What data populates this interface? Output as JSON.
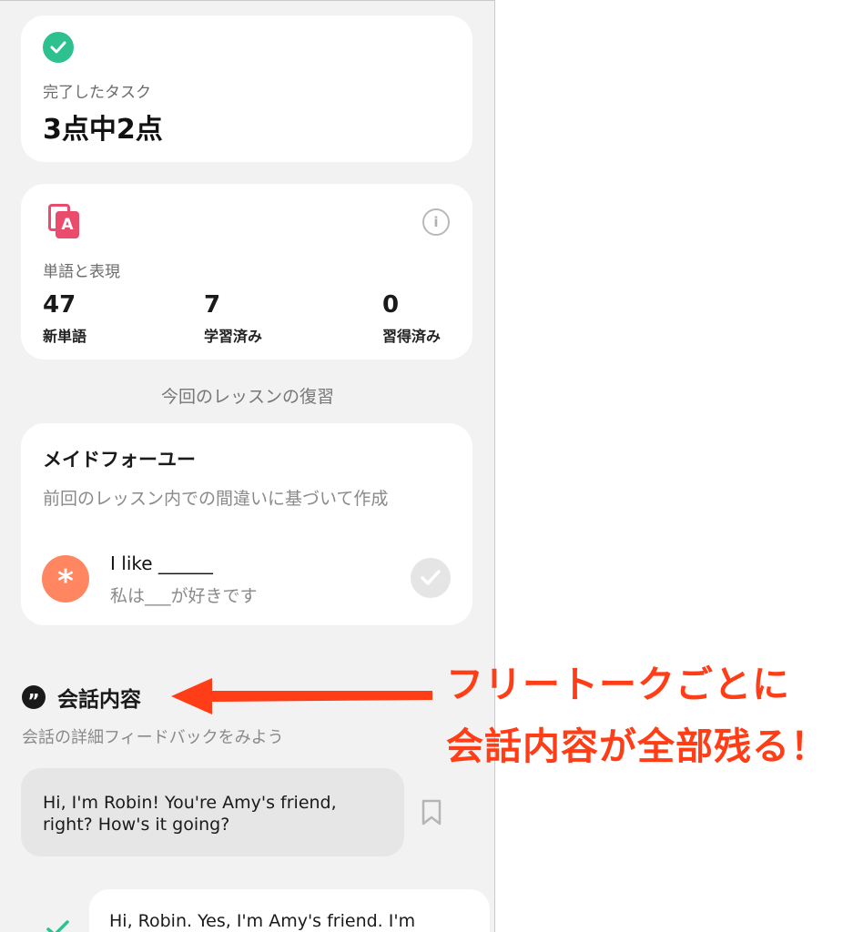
{
  "tasks_card": {
    "label": "完了したタスク",
    "value": "3点中2点",
    "icon": "check-circle-icon",
    "icon_color": "#2ec08f"
  },
  "vocab_card": {
    "icon_letter": "A",
    "icon_color": "#e94c6d",
    "info_glyph": "i",
    "title": "単語と表現",
    "stats": [
      {
        "value": "47",
        "label": "新単語"
      },
      {
        "value": "7",
        "label": "学習済み"
      },
      {
        "value": "0",
        "label": "習得済み"
      }
    ]
  },
  "review_caption": "今回のレッスンの復習",
  "made_for_you": {
    "title": "メイドフォーユー",
    "subtitle": "前回のレッスン内での間違いに基づいて作成",
    "badge_glyph": "*",
    "badge_color": "#ff8660",
    "example_en": "I like ______",
    "example_ja": "私は___が好きです"
  },
  "conversation": {
    "icon_glyph": "”",
    "title": "会話内容",
    "subtitle": "会話の詳細フィードバックをみよう",
    "messages": [
      {
        "side": "partner",
        "text": "Hi, I'm Robin! You're Amy's friend, right? How's it going?"
      },
      {
        "side": "user",
        "text": "Hi, Robin. Yes, I'm Amy's friend. I'm"
      }
    ]
  },
  "annotation": {
    "line1": "フリートークごとに",
    "line2": "会話内容が全部残る！",
    "color": "#ff3d17"
  }
}
